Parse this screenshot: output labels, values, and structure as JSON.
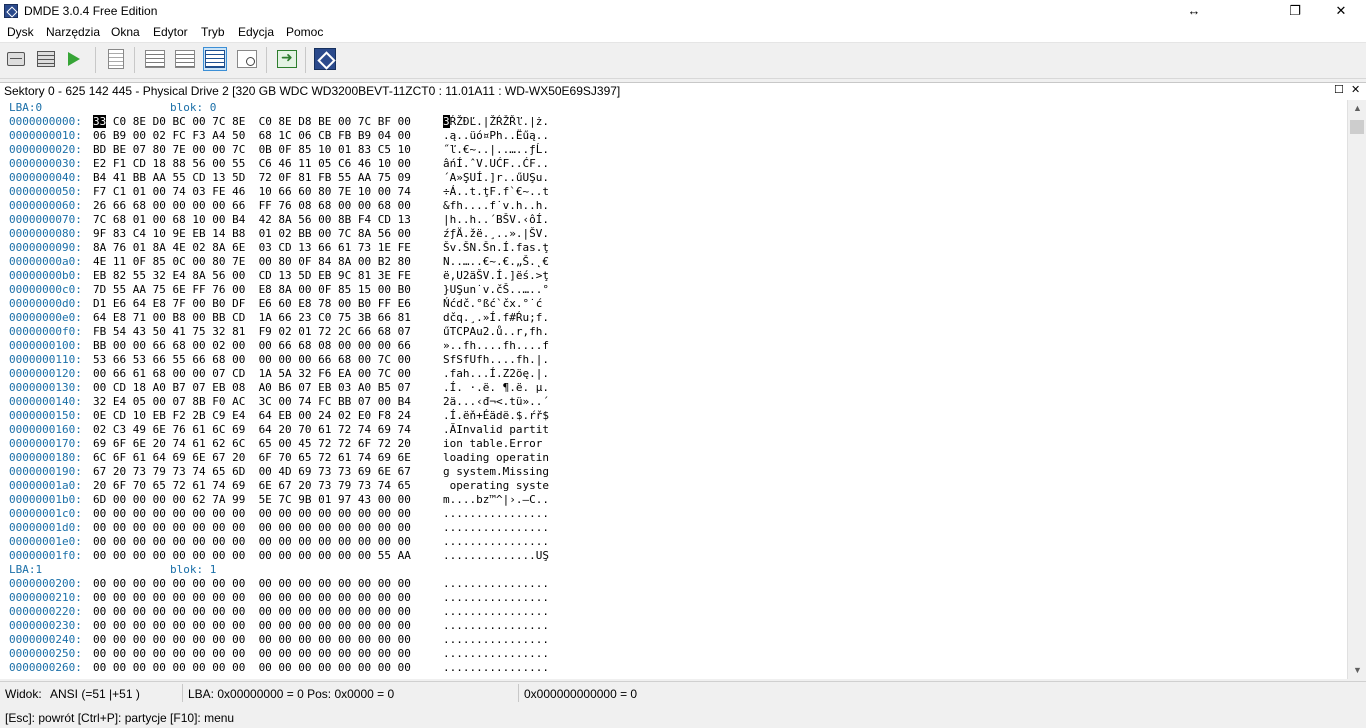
{
  "window": {
    "title": "DMDE 3.0.4 Free Edition",
    "controls": {
      "resize": "↔",
      "restore": "❐",
      "close": "✕"
    }
  },
  "menu": [
    "Dysk",
    "Narzędzia",
    "Okna",
    "Edytor",
    "Tryb",
    "Edycja",
    "Pomoc"
  ],
  "toolbar": {
    "buttons": [
      "disk-icon",
      "partitions-icon",
      "play-icon",
      "document-icon",
      "tree-icon",
      "hex-view-icon",
      "find-icon",
      "goto-icon",
      "dmde-logo-icon"
    ]
  },
  "panel": {
    "title": "Sektory 0 - 625 142 445 - Physical Drive 2 [320 GB WDC WD3200BEVT-11ZCT0 : 11.01A11 : WD-WX50E69SJ397]",
    "maximize": "☐",
    "close": "✕"
  },
  "hex": {
    "lines": [
      {
        "type": "header",
        "lba": "LBA:0",
        "blok": "blok: 0"
      },
      {
        "addr": "0000000000:",
        "hex": "33 C0 8E D0 BC 00 7C 8E  C0 8E D8 BE 00 7C BF 00",
        "ascii": "3ŔŽĐĽ.|ŽŔŽŘľ.|ż."
      },
      {
        "addr": "0000000010:",
        "hex": "06 B9 00 02 FC F3 A4 50  68 1C 06 CB FB B9 04 00",
        "ascii": ".ą..üó¤Ph..Ëűą.."
      },
      {
        "addr": "0000000020:",
        "hex": "BD BE 07 80 7E 00 00 7C  0B 0F 85 10 01 83 C5 10",
        "ascii": "˝ľ.€~..|..…..ƒĹ."
      },
      {
        "addr": "0000000030:",
        "hex": "E2 F1 CD 18 88 56 00 55  C6 46 11 05 C6 46 10 00",
        "ascii": "âńÍ.ˆV.UĆF..ĆF.."
      },
      {
        "addr": "0000000040:",
        "hex": "B4 41 BB AA 55 CD 13 5D  72 0F 81 FB 55 AA 75 09",
        "ascii": "´A»ŞUÍ.]r..űUŞu."
      },
      {
        "addr": "0000000050:",
        "hex": "F7 C1 01 00 74 03 FE 46  10 66 60 80 7E 10 00 74",
        "ascii": "÷Á..t.ţF.f`€~..t"
      },
      {
        "addr": "0000000060:",
        "hex": "26 66 68 00 00 00 00 66  FF 76 08 68 00 00 68 00",
        "ascii": "&fh....f˙v.h..h."
      },
      {
        "addr": "0000000070:",
        "hex": "7C 68 01 00 68 10 00 B4  42 8A 56 00 8B F4 CD 13",
        "ascii": "|h..h..´BŠV.‹ôÍ."
      },
      {
        "addr": "0000000080:",
        "hex": "9F 83 C4 10 9E EB 14 B8  01 02 BB 00 7C 8A 56 00",
        "ascii": "źƒÄ.žë.¸..».|ŠV."
      },
      {
        "addr": "0000000090:",
        "hex": "8A 76 01 8A 4E 02 8A 6E  03 CD 13 66 61 73 1E FE",
        "ascii": "Šv.ŠN.Šn.Í.fas.ţ"
      },
      {
        "addr": "00000000a0:",
        "hex": "4E 11 0F 85 0C 00 80 7E  00 80 0F 84 8A 00 B2 80",
        "ascii": "N..…..€~.€.„Š.˛€"
      },
      {
        "addr": "00000000b0:",
        "hex": "EB 82 55 32 E4 8A 56 00  CD 13 5D EB 9C 81 3E FE",
        "ascii": "ë‚U2äŠV.Í.]ëś.>ţ"
      },
      {
        "addr": "00000000c0:",
        "hex": "7D 55 AA 75 6E FF 76 00  E8 8A 00 0F 85 15 00 B0",
        "ascii": "}UŞun˙v.čŠ..…..°"
      },
      {
        "addr": "00000000d0:",
        "hex": "D1 E6 64 E8 7F 00 B0 DF  E6 60 E8 78 00 B0 FF E6",
        "ascii": "Ńćdč.°ßć`čx.°˙ć"
      },
      {
        "addr": "00000000e0:",
        "hex": "64 E8 71 00 B8 00 BB CD  1A 66 23 C0 75 3B 66 81",
        "ascii": "dčq.¸.»Í.f#Ŕu;f."
      },
      {
        "addr": "00000000f0:",
        "hex": "FB 54 43 50 41 75 32 81  F9 02 01 72 2C 66 68 07",
        "ascii": "űTCPAu2.ů..r,fh."
      },
      {
        "addr": "0000000100:",
        "hex": "BB 00 00 66 68 00 02 00  00 66 68 08 00 00 00 66",
        "ascii": "»..fh....fh....f"
      },
      {
        "addr": "0000000110:",
        "hex": "53 66 53 66 55 66 68 00  00 00 00 66 68 00 7C 00",
        "ascii": "SfSfUfh....fh.|."
      },
      {
        "addr": "0000000120:",
        "hex": "00 66 61 68 00 00 07 CD  1A 5A 32 F6 EA 00 7C 00",
        "ascii": ".fah...Í.Z2öę.|."
      },
      {
        "addr": "0000000130:",
        "hex": "00 CD 18 A0 B7 07 EB 08  A0 B6 07 EB 03 A0 B5 07",
        "ascii": ".Í. ·.ë. ¶.ë. µ."
      },
      {
        "addr": "0000000140:",
        "hex": "32 E4 05 00 07 8B F0 AC  3C 00 74 FC BB 07 00 B4",
        "ascii": "2ä...‹đ¬<.tü»..´"
      },
      {
        "addr": "0000000150:",
        "hex": "0E CD 10 EB F2 2B C9 E4  64 EB 00 24 02 E0 F8 24",
        "ascii": ".Í.ëň+Éädë.$.ŕř$"
      },
      {
        "addr": "0000000160:",
        "hex": "02 C3 49 6E 76 61 6C 69  64 20 70 61 72 74 69 74",
        "ascii": ".ĂInvalid partit"
      },
      {
        "addr": "0000000170:",
        "hex": "69 6F 6E 20 74 61 62 6C  65 00 45 72 72 6F 72 20",
        "ascii": "ion table.Error "
      },
      {
        "addr": "0000000180:",
        "hex": "6C 6F 61 64 69 6E 67 20  6F 70 65 72 61 74 69 6E",
        "ascii": "loading operatin"
      },
      {
        "addr": "0000000190:",
        "hex": "67 20 73 79 73 74 65 6D  00 4D 69 73 73 69 6E 67",
        "ascii": "g system.Missing"
      },
      {
        "addr": "00000001a0:",
        "hex": "20 6F 70 65 72 61 74 69  6E 67 20 73 79 73 74 65",
        "ascii": " operating syste"
      },
      {
        "addr": "00000001b0:",
        "hex": "6D 00 00 00 00 62 7A 99  5E 7C 9B 01 97 43 00 00",
        "ascii": "m....bz™^|›.—C.."
      },
      {
        "addr": "00000001c0:",
        "hex": "00 00 00 00 00 00 00 00  00 00 00 00 00 00 00 00",
        "ascii": "................"
      },
      {
        "addr": "00000001d0:",
        "hex": "00 00 00 00 00 00 00 00  00 00 00 00 00 00 00 00",
        "ascii": "................"
      },
      {
        "addr": "00000001e0:",
        "hex": "00 00 00 00 00 00 00 00  00 00 00 00 00 00 00 00",
        "ascii": "................"
      },
      {
        "addr": "00000001f0:",
        "hex": "00 00 00 00 00 00 00 00  00 00 00 00 00 00 55 AA",
        "ascii": "..............UŞ"
      },
      {
        "type": "header",
        "lba": "LBA:1",
        "blok": "blok: 1"
      },
      {
        "addr": "0000000200:",
        "hex": "00 00 00 00 00 00 00 00  00 00 00 00 00 00 00 00",
        "ascii": "................"
      },
      {
        "addr": "0000000210:",
        "hex": "00 00 00 00 00 00 00 00  00 00 00 00 00 00 00 00",
        "ascii": "................"
      },
      {
        "addr": "0000000220:",
        "hex": "00 00 00 00 00 00 00 00  00 00 00 00 00 00 00 00",
        "ascii": "................"
      },
      {
        "addr": "0000000230:",
        "hex": "00 00 00 00 00 00 00 00  00 00 00 00 00 00 00 00",
        "ascii": "................"
      },
      {
        "addr": "0000000240:",
        "hex": "00 00 00 00 00 00 00 00  00 00 00 00 00 00 00 00",
        "ascii": "................"
      },
      {
        "addr": "0000000250:",
        "hex": "00 00 00 00 00 00 00 00  00 00 00 00 00 00 00 00",
        "ascii": "................"
      },
      {
        "addr": "0000000260:",
        "hex": "00 00 00 00 00 00 00 00  00 00 00 00 00 00 00 00",
        "ascii": "................"
      }
    ]
  },
  "status": {
    "view": "Widok:",
    "encoding": "ANSI (=51 |+51 )",
    "lba_pos": "LBA: 0x00000000 = 0  Pos: 0x0000 = 0",
    "offset": "0x000000000000 = 0"
  },
  "hint": "[Esc]: powrót  [Ctrl+P]: partycje  [F10]: menu",
  "colors": {
    "address": "#1a6fa8",
    "accent": "#2b4a8c"
  }
}
